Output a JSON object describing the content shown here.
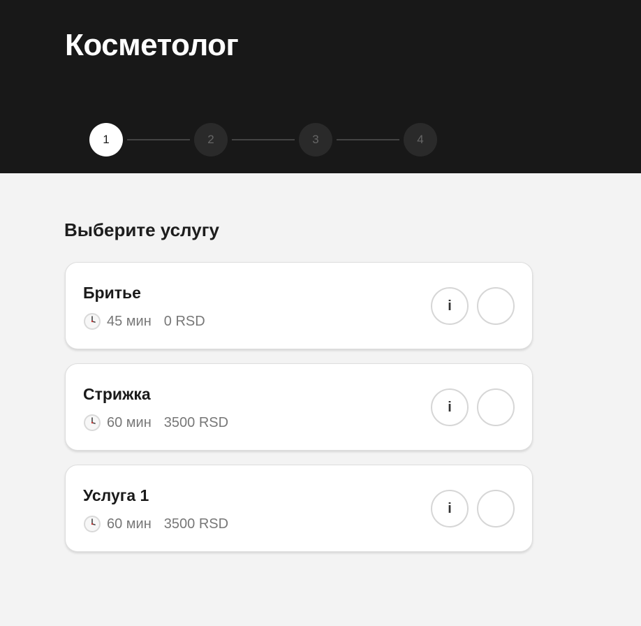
{
  "header": {
    "title": "Косметолог"
  },
  "stepper": {
    "steps": [
      {
        "label": "1",
        "active": true
      },
      {
        "label": "2",
        "active": false
      },
      {
        "label": "3",
        "active": false
      },
      {
        "label": "4",
        "active": false
      }
    ]
  },
  "main": {
    "section_title": "Выберите услугу",
    "services": [
      {
        "name": "Бритье",
        "duration": "45 мин",
        "price": "0 RSD",
        "info_label": "i",
        "clock_icon": "clock-icon"
      },
      {
        "name": "Стрижка",
        "duration": "60 мин",
        "price": "3500 RSD",
        "info_label": "i",
        "clock_icon": "clock-icon"
      },
      {
        "name": "Услуга 1",
        "duration": "60 мин",
        "price": "3500 RSD",
        "info_label": "i",
        "clock_icon": "clock-icon"
      }
    ]
  },
  "colors": {
    "header_bg": "#181818",
    "page_bg": "#f3f3f3",
    "active_step_bg": "#ffffff",
    "inactive_step_bg": "#2a2a2a"
  }
}
